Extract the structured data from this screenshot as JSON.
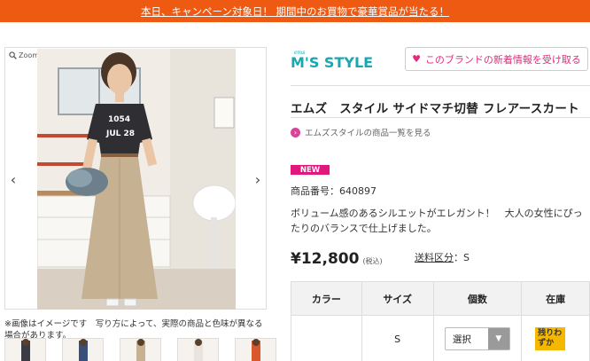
{
  "banner": {
    "text": "本日、キャンペーン対象日！ 期間中のお買物で豪華賞品が当たる！"
  },
  "viewer": {
    "zoom_label": "Zoom",
    "prev": "‹",
    "next": "›"
  },
  "photo": {
    "shirt_print_line1": "1054",
    "shirt_print_line2": "JUL 28"
  },
  "image_note": "※画像はイメージです　写り方によって、実際の商品と色味が異なる場合があります。",
  "brand": {
    "logo_text": "M'S STYLE",
    "follow_label": "このブランドの新着情報を受け取る",
    "list_link": "エムズスタイルの商品一覧を見る"
  },
  "product": {
    "title": "エムズ　スタイル サイドマチ切替 フレアースカート",
    "badge": "NEW",
    "code": "商品番号：640897",
    "description": "ボリューム感のあるシルエットがエレガント！　大人の女性にぴったりのバランスで仕上げました。",
    "price": "¥12,800",
    "tax": "(税込)",
    "shipping_label": "送料区分",
    "shipping_value": "：S"
  },
  "table": {
    "headers": [
      "カラー",
      "サイズ",
      "個数",
      "在庫"
    ],
    "rows": [
      {
        "color": "",
        "size": "S",
        "qty": "選択",
        "stock": "残りわずか"
      }
    ]
  },
  "colors": {
    "banner": "#ef5a12",
    "accent": "#e0177d",
    "brand_teal": "#1aa7b0",
    "stock": "#f5b800"
  }
}
